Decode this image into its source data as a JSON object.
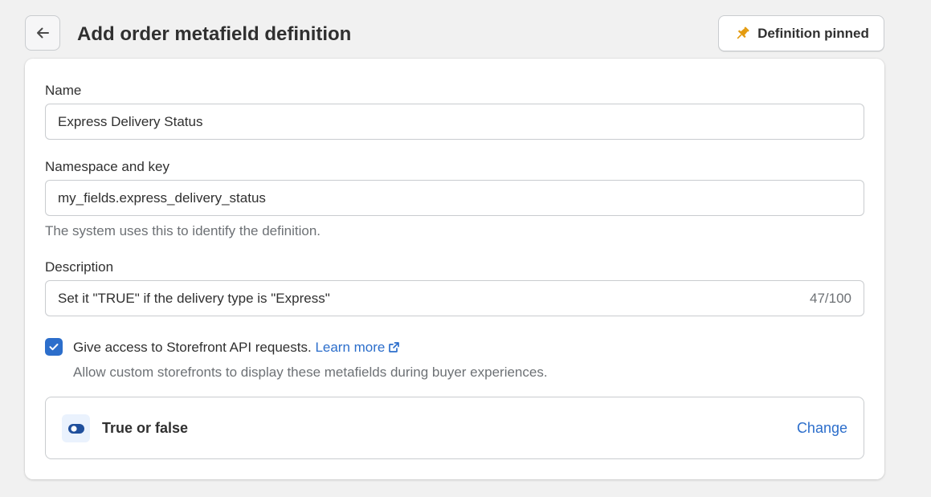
{
  "header": {
    "title": "Add order metafield definition",
    "pin_button_label": "Definition pinned",
    "back_icon": "arrow-left-icon",
    "pin_icon": "pin-icon"
  },
  "form": {
    "name": {
      "label": "Name",
      "value": "Express Delivery Status"
    },
    "namespace_key": {
      "label": "Namespace and key",
      "value": "my_fields.express_delivery_status",
      "help": "The system uses this to identify the definition."
    },
    "description": {
      "label": "Description",
      "value": "Set it \"TRUE\" if the delivery type is \"Express\"",
      "counter": "47/100"
    },
    "storefront_access": {
      "checked": true,
      "label": "Give access to Storefront API requests.",
      "link_label": "Learn more",
      "help": "Allow custom storefronts to display these metafields during buyer experiences."
    },
    "type": {
      "label": "True or false",
      "icon": "toggle-icon",
      "change_label": "Change"
    }
  },
  "colors": {
    "accent": "#2c6ecb",
    "pin": "#e49b0f",
    "background": "#f1f1f1"
  }
}
